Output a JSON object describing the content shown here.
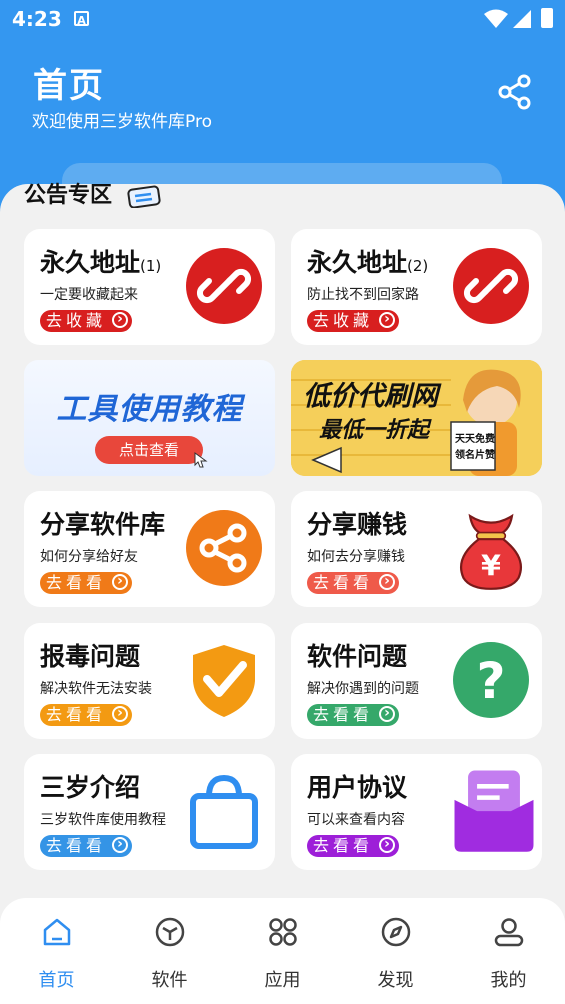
{
  "status_bar": {
    "time": "4:23",
    "notif_icon": "a-notification-icon"
  },
  "header": {
    "title": "首页",
    "subtitle": "欢迎使用三岁软件库Pro",
    "share_icon": "share-icon"
  },
  "notice": {
    "label": "公告专区"
  },
  "cards": [
    {
      "title": "永久地址",
      "suffix": "(1)",
      "sub": "一定要收藏起来",
      "btn": "去收藏",
      "btn_color": "#d81f1f",
      "icon": "link-icon"
    },
    {
      "title": "永久地址",
      "suffix": "(2)",
      "sub": "防止找不到回家路",
      "btn": "去收藏",
      "btn_color": "#d81f1f",
      "icon": "link-icon"
    },
    {
      "title": "分享软件库",
      "sub": "如何分享给好友",
      "btn": "去看看",
      "btn_color": "#f07a18",
      "icon": "share-circle-icon"
    },
    {
      "title": "分享赚钱",
      "sub": "如何去分享赚钱",
      "btn": "去看看",
      "btn_color": "#ef5a4a",
      "icon": "money-bag-icon"
    },
    {
      "title": "报毒问题",
      "sub": "解决软件无法安装",
      "btn": "去看看",
      "btn_color": "#f39a12",
      "icon": "shield-check-icon"
    },
    {
      "title": "软件问题",
      "sub": "解决你遇到的问题",
      "btn": "去看看",
      "btn_color": "#35a86a",
      "icon": "question-icon"
    },
    {
      "title": "三岁介绍",
      "sub": "三岁软件库使用教程",
      "btn": "去看看",
      "btn_color": "#3494e6",
      "icon": "shopping-bag-icon"
    },
    {
      "title": "用户协议",
      "sub": "可以来查看内容",
      "btn": "去看看",
      "btn_color": "#9d1fd8",
      "icon": "document-box-icon"
    }
  ],
  "banners": {
    "tutorial": {
      "title": "工具使用教程",
      "button": "点击查看"
    },
    "promo": {
      "line1": "低价代刷网",
      "line2": "最低一折起",
      "tag1": "天天免费",
      "tag2": "领名片赞"
    }
  },
  "nav": [
    {
      "label": "首页",
      "icon": "home-icon",
      "active": true
    },
    {
      "label": "软件",
      "icon": "cube-icon",
      "active": false
    },
    {
      "label": "应用",
      "icon": "grid-icon",
      "active": false
    },
    {
      "label": "发现",
      "icon": "compass-icon",
      "active": false
    },
    {
      "label": "我的",
      "icon": "user-icon",
      "active": false
    }
  ],
  "colors": {
    "primary": "#3497f0",
    "active_nav": "#2f8ef0"
  }
}
